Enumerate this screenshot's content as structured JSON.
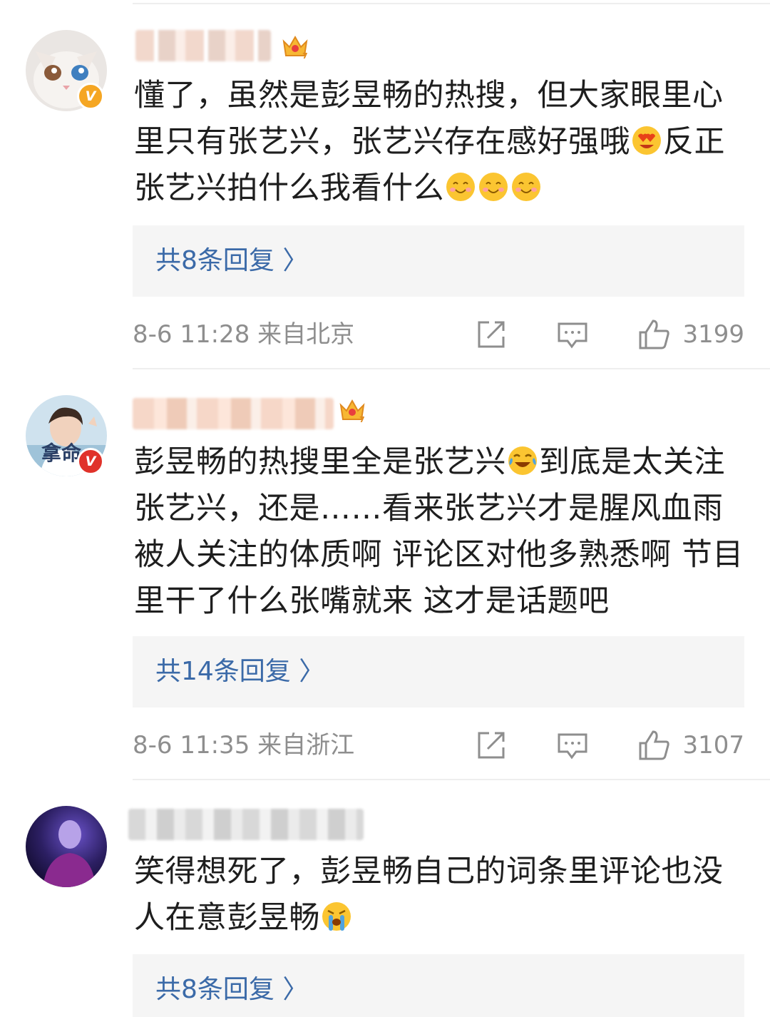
{
  "comments": [
    {
      "text_parts": [
        "懂了，虽然是彭昱畅的热搜，但大家眼里心里只有张艺兴，张艺兴存在感好强哦",
        "反正张艺兴拍什么我看什么",
        ""
      ],
      "emojis": [
        "heart-eyes",
        "smile-blush",
        "smile-blush",
        "smile-blush"
      ],
      "reply_label": "共8条回复 〉",
      "timestamp": "8-6 11:28",
      "location": "来自北京",
      "likes": "3199",
      "badge": "V",
      "avatar_text": ""
    },
    {
      "text_parts": [
        "彭昱畅的热搜里全是张艺兴",
        "到底是太关注张艺兴，还是……看来张艺兴才是腥风血雨被人关注的体质啊 评论区对他多熟悉啊 节目里干了什么张嘴就来 这才是话题吧"
      ],
      "emojis": [
        "laugh-cry"
      ],
      "reply_label": "共14条回复 〉",
      "timestamp": "8-6 11:35",
      "location": "来自浙江",
      "likes": "3107",
      "badge": "V",
      "avatar_text": "拿命"
    },
    {
      "text_parts": [
        "笑得想死了，彭昱畅自己的词条里评论也没人在意彭昱畅",
        ""
      ],
      "emojis": [
        "crying"
      ],
      "reply_label": "共8条回复 〉"
    }
  ]
}
